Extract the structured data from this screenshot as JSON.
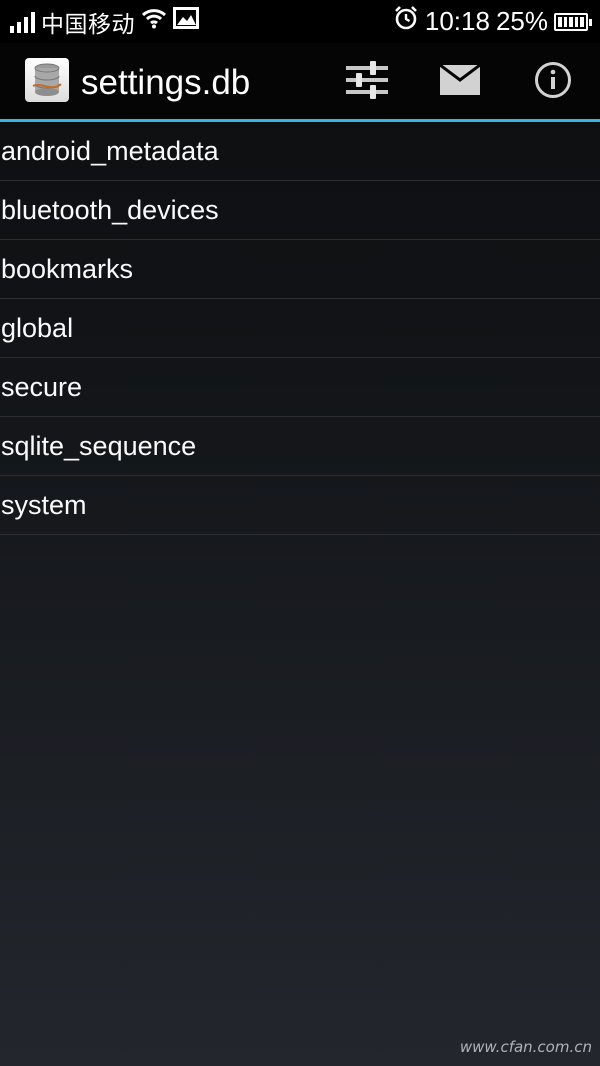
{
  "status_bar": {
    "carrier": "中国移动",
    "time": "10:18",
    "battery": "25%",
    "icons": [
      "signal-icon",
      "wifi-icon",
      "gallery-icon",
      "alarm-icon",
      "battery-icon"
    ]
  },
  "action_bar": {
    "title": "settings.db",
    "icons": [
      "database-icon",
      "sliders-icon",
      "mail-icon",
      "info-icon"
    ],
    "accent_color": "#33b5e5"
  },
  "tables": [
    "android_metadata",
    "bluetooth_devices",
    "bookmarks",
    "global",
    "secure",
    "sqlite_sequence",
    "system"
  ],
  "watermark": "www.cfan.com.cn"
}
